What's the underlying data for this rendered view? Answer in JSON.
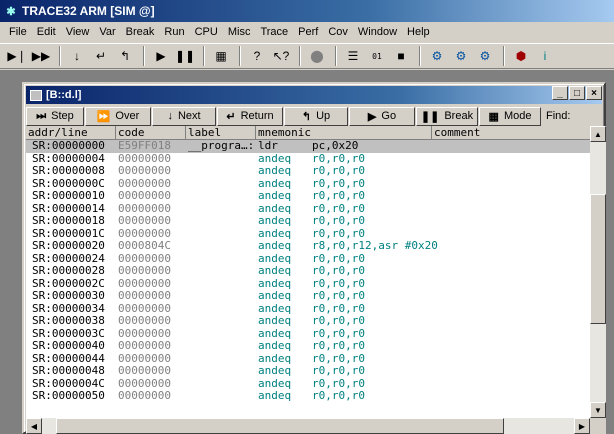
{
  "app": {
    "title": "TRACE32 ARM [SIM @]"
  },
  "menu": [
    "File",
    "Edit",
    "View",
    "Var",
    "Break",
    "Run",
    "CPU",
    "Misc",
    "Trace",
    "Perf",
    "Cov",
    "Window",
    "Help"
  ],
  "toolbar_icons": [
    "step-icon",
    "step-over-icon",
    "step-down-icon",
    "step-return-icon",
    "step-up-icon",
    "go-icon",
    "break-icon",
    "noreg-icon",
    "help-icon",
    "help-context-icon",
    "stop-icon",
    "list-icon",
    "memory-icon",
    "register-icon",
    "cpu-icon",
    "cpu2-icon",
    "cpu3-icon",
    "trace-icon",
    "info-icon"
  ],
  "window": {
    "title": "[B::d.l]",
    "controls": {
      "minimize": "_",
      "maximize": "□",
      "close": "×"
    }
  },
  "commands": [
    {
      "icon": "⏭",
      "label": "Step",
      "name": "step"
    },
    {
      "icon": "⏩",
      "label": "Over",
      "name": "over"
    },
    {
      "icon": "↓",
      "label": "Next",
      "name": "next"
    },
    {
      "icon": "↵",
      "label": "Return",
      "name": "return"
    },
    {
      "icon": "↰",
      "label": "Up",
      "name": "up"
    },
    {
      "icon": "▶",
      "label": "Go",
      "name": "go"
    },
    {
      "icon": "❚❚",
      "label": "Break",
      "name": "break"
    },
    {
      "icon": "▦",
      "label": "Mode",
      "name": "mode"
    }
  ],
  "find_label": "Find:",
  "columns": [
    "addr/line",
    "code",
    "label",
    "mnemonic",
    "comment"
  ],
  "rows": [
    {
      "addr": "SR:00000000",
      "code": "E59FF018",
      "label": "__progra…:",
      "mnemonic": "ldr",
      "operands": "pc,0x20",
      "selected": true
    },
    {
      "addr": "SR:00000004",
      "code": "00000000",
      "label": "",
      "mnemonic": "andeq",
      "operands": "r0,r0,r0"
    },
    {
      "addr": "SR:00000008",
      "code": "00000000",
      "label": "",
      "mnemonic": "andeq",
      "operands": "r0,r0,r0"
    },
    {
      "addr": "SR:0000000C",
      "code": "00000000",
      "label": "",
      "mnemonic": "andeq",
      "operands": "r0,r0,r0"
    },
    {
      "addr": "SR:00000010",
      "code": "00000000",
      "label": "",
      "mnemonic": "andeq",
      "operands": "r0,r0,r0"
    },
    {
      "addr": "SR:00000014",
      "code": "00000000",
      "label": "",
      "mnemonic": "andeq",
      "operands": "r0,r0,r0"
    },
    {
      "addr": "SR:00000018",
      "code": "00000000",
      "label": "",
      "mnemonic": "andeq",
      "operands": "r0,r0,r0"
    },
    {
      "addr": "SR:0000001C",
      "code": "00000000",
      "label": "",
      "mnemonic": "andeq",
      "operands": "r0,r0,r0"
    },
    {
      "addr": "SR:00000020",
      "code": "0000804C",
      "label": "",
      "mnemonic": "andeq",
      "operands": "r8,r0,r12,asr #0x20"
    },
    {
      "addr": "SR:00000024",
      "code": "00000000",
      "label": "",
      "mnemonic": "andeq",
      "operands": "r0,r0,r0"
    },
    {
      "addr": "SR:00000028",
      "code": "00000000",
      "label": "",
      "mnemonic": "andeq",
      "operands": "r0,r0,r0"
    },
    {
      "addr": "SR:0000002C",
      "code": "00000000",
      "label": "",
      "mnemonic": "andeq",
      "operands": "r0,r0,r0"
    },
    {
      "addr": "SR:00000030",
      "code": "00000000",
      "label": "",
      "mnemonic": "andeq",
      "operands": "r0,r0,r0"
    },
    {
      "addr": "SR:00000034",
      "code": "00000000",
      "label": "",
      "mnemonic": "andeq",
      "operands": "r0,r0,r0"
    },
    {
      "addr": "SR:00000038",
      "code": "00000000",
      "label": "",
      "mnemonic": "andeq",
      "operands": "r0,r0,r0"
    },
    {
      "addr": "SR:0000003C",
      "code": "00000000",
      "label": "",
      "mnemonic": "andeq",
      "operands": "r0,r0,r0"
    },
    {
      "addr": "SR:00000040",
      "code": "00000000",
      "label": "",
      "mnemonic": "andeq",
      "operands": "r0,r0,r0"
    },
    {
      "addr": "SR:00000044",
      "code": "00000000",
      "label": "",
      "mnemonic": "andeq",
      "operands": "r0,r0,r0"
    },
    {
      "addr": "SR:00000048",
      "code": "00000000",
      "label": "",
      "mnemonic": "andeq",
      "operands": "r0,r0,r0"
    },
    {
      "addr": "SR:0000004C",
      "code": "00000000",
      "label": "",
      "mnemonic": "andeq",
      "operands": "r0,r0,r0"
    },
    {
      "addr": "SR:00000050",
      "code": "00000000",
      "label": "",
      "mnemonic": "andeq",
      "operands": "r0,r0,r0"
    }
  ],
  "scroll": {
    "vertical_position": 0.4,
    "horizontal_position": 0.17
  }
}
